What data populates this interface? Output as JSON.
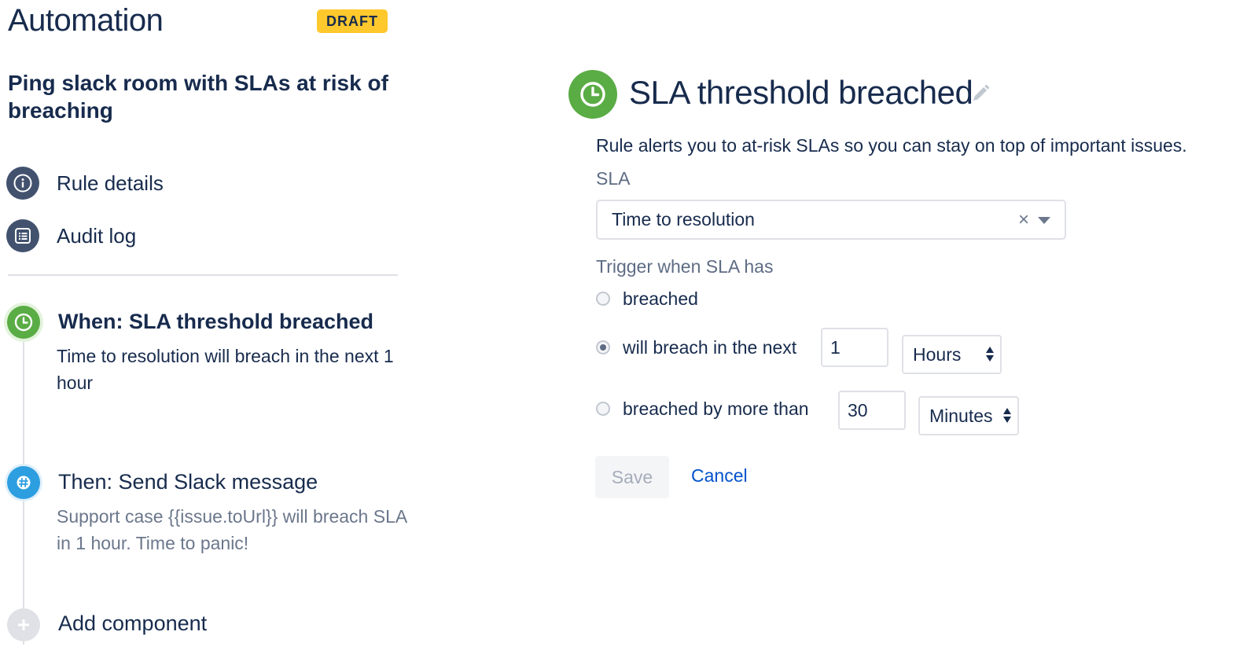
{
  "header": {
    "title": "Automation",
    "status_badge": "DRAFT",
    "rule_name": "Ping slack room with SLAs at risk of breaching"
  },
  "nav": {
    "rule_details": "Rule details",
    "audit_log": "Audit log"
  },
  "steps": {
    "when": {
      "title": "When: SLA threshold breached",
      "description": "Time to resolution will breach in the next 1 hour"
    },
    "then": {
      "title": "Then: Send Slack message",
      "description": "Support case {{issue.toUrl}} will breach SLA in 1 hour. Time to panic!"
    },
    "add": {
      "label": "Add component"
    }
  },
  "panel": {
    "title": "SLA threshold breached",
    "description": "Rule alerts you to at-risk SLAs so you can stay on top of important issues.",
    "sla_label": "SLA",
    "sla_value": "Time to resolution",
    "trigger_label": "Trigger when SLA has",
    "options": {
      "breached": "breached",
      "will_breach": "will breach in the next",
      "breached_more": "breached by more than"
    },
    "will_breach_value": "1",
    "will_breach_unit": "Hours",
    "breached_more_value": "30",
    "breached_more_unit": "Minutes",
    "selected_option": "will_breach",
    "save_label": "Save",
    "cancel_label": "Cancel"
  },
  "colors": {
    "trigger_green": "#5aac44",
    "slack_blue": "#2d9ee0",
    "nav_icon": "#42526e",
    "badge_yellow": "#ffc82c",
    "link_blue": "#0052cc"
  },
  "icons": {
    "rule_details": "info-icon",
    "audit_log": "list-icon",
    "when": "clock-icon",
    "then": "slack-icon",
    "add": "plus-icon",
    "edit": "pencil-icon"
  }
}
